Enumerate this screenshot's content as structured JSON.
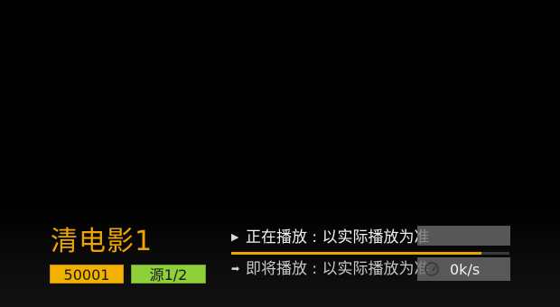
{
  "player": {
    "channel_title": "清电影1",
    "channel_number": "50001",
    "source": "源1/2"
  },
  "epg": {
    "now_playing": "正在播放 : 以实际播放为准",
    "up_next": "即将播放 : 以实际播放为准",
    "progress_percent": 90
  },
  "network": {
    "speed": "0k/s",
    "speed_icon": "speedometer-icon"
  },
  "colors": {
    "accent": "#f0a400",
    "source_badge": "#8fcf3a",
    "background": "#000000"
  }
}
